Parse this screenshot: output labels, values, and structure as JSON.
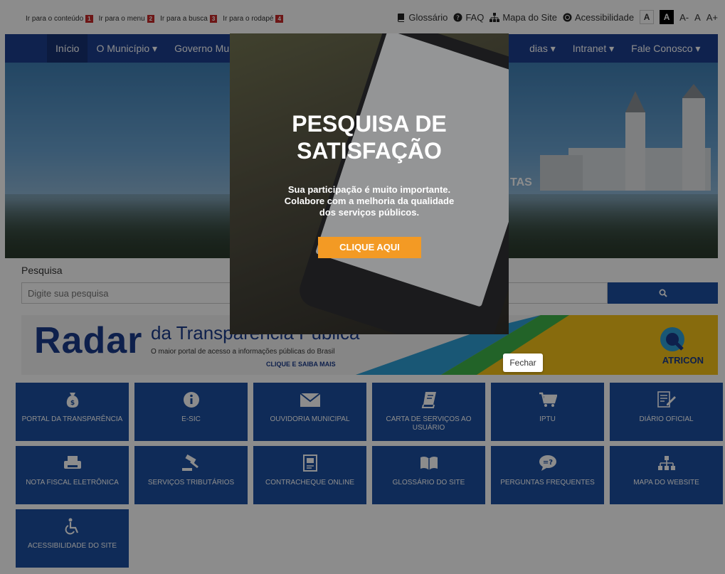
{
  "skip_links": [
    {
      "label": "Ir para o conteúdo",
      "num": "1"
    },
    {
      "label": "Ir para o menu",
      "num": "2"
    },
    {
      "label": "Ir para a busca",
      "num": "3"
    },
    {
      "label": "Ir para o rodapé",
      "num": "4"
    }
  ],
  "top_links": {
    "glossario": "Glossário",
    "faq": "FAQ",
    "mapa": "Mapa do Site",
    "acessibilidade": "Acessibilidade",
    "font_a": "A",
    "font_a_dark": "A",
    "font_minus": "A-",
    "font_normal": "A",
    "font_plus": "A+"
  },
  "nav": {
    "items": [
      "Início",
      "O Município ▾",
      "Governo Mu",
      "dias ▾",
      "Intranet ▾",
      "Fale Conosco ▾"
    ]
  },
  "search": {
    "label": "Pesquisa",
    "placeholder": "Digite sua pesquisa"
  },
  "radar": {
    "word": "Radar",
    "subtitle": "da Transparência Pública",
    "tagline": "O maior portal de acesso a informações públicas do Brasil",
    "cta": "CLIQUE E SAIBA MAIS",
    "brand": "ATRICON"
  },
  "banner": {
    "partial_text": "TAS"
  },
  "tiles": [
    {
      "label": "PORTAL DA TRANSPARÊNCIA",
      "icon": "money-bag-icon"
    },
    {
      "label": "E-SIC",
      "icon": "info-icon"
    },
    {
      "label": "OUVIDORIA MUNICIPAL",
      "icon": "envelope-icon"
    },
    {
      "label": "CARTA DE SERVIÇOS AO USUÁRIO",
      "icon": "book-icon"
    },
    {
      "label": "IPTU",
      "icon": "cart-icon"
    },
    {
      "label": "DIÁRIO OFICIAL",
      "icon": "edit-document-icon"
    },
    {
      "label": "NOTA FISCAL ELETRÔNICA",
      "icon": "printer-icon"
    },
    {
      "label": "SERVIÇOS TRIBUTÁRIOS",
      "icon": "gavel-icon"
    },
    {
      "label": "CONTRACHEQUE ONLINE",
      "icon": "document-icon"
    },
    {
      "label": "GLOSSÁRIO DO SITE",
      "icon": "open-book-icon"
    },
    {
      "label": "PERGUNTAS FREQUENTES",
      "icon": "question-bubble-icon"
    },
    {
      "label": "MAPA DO WEBSITE",
      "icon": "sitemap-icon"
    },
    {
      "label": "ACESSIBILIDADE DO SITE",
      "icon": "wheelchair-icon"
    }
  ],
  "modal": {
    "title_line1": "PESQUISA DE",
    "title_line2": "SATISFAÇÃO",
    "msg_line1": "Sua participação é muito importante.",
    "msg_line2": "Colabore com a melhoria da qualidade",
    "msg_line3": "dos serviços públicos.",
    "cta": "CLIQUE AQUI",
    "close": "Fechar"
  },
  "colors": {
    "nav": "#1c3e8f",
    "tile": "#1c4fa0",
    "cta": "#f39a24",
    "skip_num": "#c62828"
  }
}
